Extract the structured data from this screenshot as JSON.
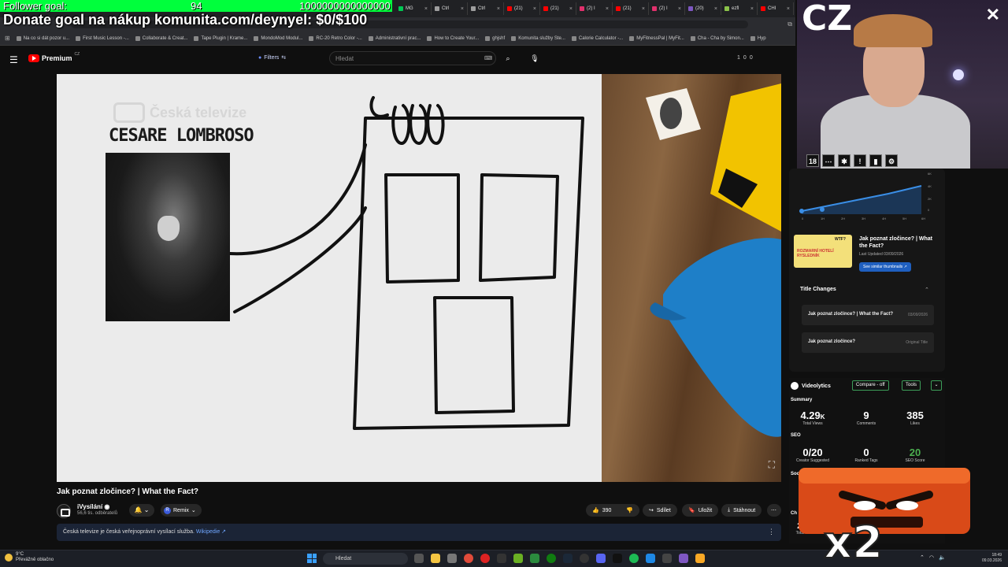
{
  "overlay": {
    "follower_label": "Follower goal:",
    "follower_current": "94",
    "follower_target": "1000000000000000",
    "donate_text": "Donate goal na nákup komunita.com/deynyel: $0/$100",
    "webcam_text": "CZ"
  },
  "browser": {
    "tabs": [
      {
        "label": "MG",
        "color": "#00c853"
      },
      {
        "label": "Ctrl",
        "color": "#9e9e9e"
      },
      {
        "label": "Ctrl",
        "color": "#9e9e9e"
      },
      {
        "label": "(21)",
        "color": "#ff0000"
      },
      {
        "label": "(21)",
        "color": "#ff0000"
      },
      {
        "label": "(2) I",
        "color": "#e1306c"
      },
      {
        "label": "(21)",
        "color": "#ff0000"
      },
      {
        "label": "(2) I",
        "color": "#e1306c"
      },
      {
        "label": "(20)",
        "color": "#7e57c2"
      },
      {
        "label": "ezfl",
        "color": "#8bc34a"
      },
      {
        "label": "CHI",
        "color": "#ff0000"
      }
    ],
    "bookmarks": [
      "Na co si dát pozor u...",
      "First Music Lesson -...",
      "Collaborate & Creat...",
      "Tape Plugin | Krame...",
      "MondoMod Modul...",
      "RC-20 Retro Color -...",
      "Administrativní prac...",
      "How to Create Your...",
      "ghjshf",
      "Komunita služby Ste...",
      "Calorie Calculator -...",
      "MyFitnessPal | MyFit...",
      "Cha - Cha by Simon...",
      "Hyp"
    ]
  },
  "youtube": {
    "logo_text": "Premium",
    "logo_country": "CZ",
    "filters_label": "Filters",
    "search_placeholder": "Hledat",
    "header_counts": [
      "1",
      "0",
      "0"
    ]
  },
  "video": {
    "watermark": "Česká televize",
    "portrait_caption": "CESARE LOMBROSO",
    "title": "Jak poznat zločince? | What the Fact?"
  },
  "channel": {
    "name": "iVysílání",
    "subscribers": "56,6 tis. odběratelů",
    "remix_label": "Remix"
  },
  "actions": {
    "likes": "390",
    "share": "Sdílet",
    "save": "Uložit",
    "download": "Stáhnout"
  },
  "description": {
    "text": "Česká televize je česká veřejnoprávní vysílací služba.",
    "link": "Wikipedie ↗"
  },
  "panel": {
    "chart_y_ticks": [
      "6K",
      "4K",
      "2K",
      "0"
    ],
    "chart_x_ticks": [
      "0",
      "1H",
      "2H",
      "3H",
      "4H",
      "5H",
      "6H"
    ],
    "thumb_title": "Jak poznat zločince? | What the Fact?",
    "thumb_updated": "Last Updated 03/09/2026",
    "thumb_button": "See similar thumbnails ↗",
    "thumb_text": "ROZMARNÍ HOTELÍ RYSLEDNÍK",
    "thumb_wtf": "WTF?",
    "title_changes_header": "Title Changes",
    "title_changes": [
      {
        "title": "Jak poznat zločince? | What the Fact?",
        "date": "03/09/2026"
      },
      {
        "title": "Jak poznat zločince?",
        "date": "Original Title"
      }
    ]
  },
  "videolytics": {
    "brand": "Videolytics",
    "compare_label": "Compare - off",
    "tools_label": "Tools",
    "summary_label": "Summary",
    "seo_label": "SEO",
    "social_label": "Social",
    "total_views": "4.29",
    "total_views_suffix": "K",
    "total_views_label": "Total Views",
    "comments": "9",
    "comments_label": "Comments",
    "likes": "385",
    "likes_label": "Likes",
    "creator_suggested": "0/20",
    "creator_suggested_label": "Creator Suggested",
    "ranked_tags": "0",
    "ranked_tags_label": "Ranked Tags",
    "seo_score": "20",
    "seo_score_label": "SEO Score",
    "partial_value": "22.9",
    "partial_label": "Total View",
    "partial_section": "Ch"
  },
  "overlay_bottom": {
    "multiplier": "x2"
  },
  "taskbar": {
    "weather_temp": "9°C",
    "weather_desc": "Převážně oblačno",
    "search_placeholder": "Hledat",
    "time": "18:49",
    "date": "09.03.2026"
  }
}
